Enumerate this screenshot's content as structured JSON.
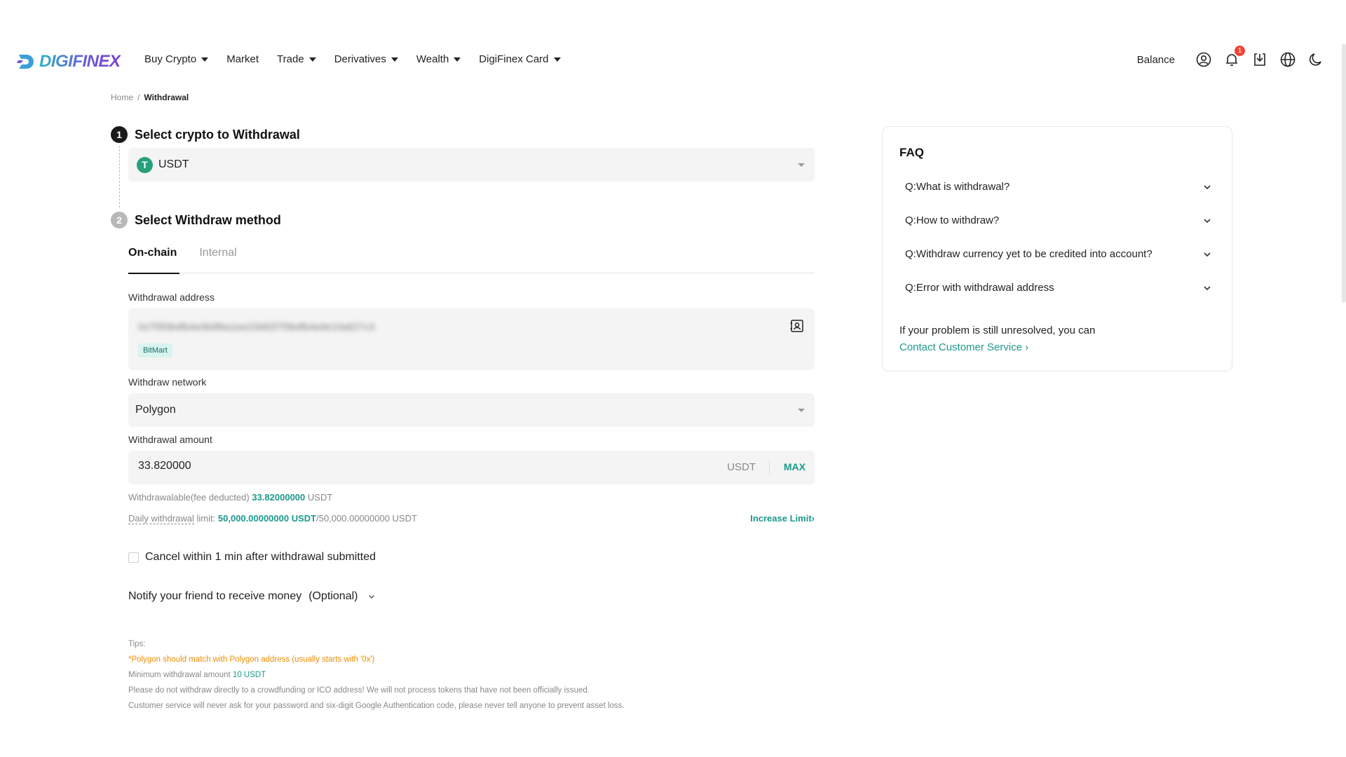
{
  "brand": {
    "name": "DIGIFINEX"
  },
  "nav": {
    "items": [
      {
        "label": "Buy Crypto",
        "dropdown": true
      },
      {
        "label": "Market",
        "dropdown": false
      },
      {
        "label": "Trade",
        "dropdown": true
      },
      {
        "label": "Derivatives",
        "dropdown": true
      },
      {
        "label": "Wealth",
        "dropdown": true
      },
      {
        "label": "DigiFinex Card",
        "dropdown": true
      }
    ],
    "balance_label": "Balance",
    "notification_count": "1",
    "icons": [
      "user-icon",
      "bell-icon",
      "download-icon",
      "globe-icon",
      "moon-icon"
    ]
  },
  "breadcrumb": {
    "home": "Home",
    "separator": "/",
    "current": "Withdrawal"
  },
  "step1": {
    "number": "1",
    "title": "Select crypto to Withdrawal",
    "coin_symbol": "T",
    "coin": "USDT"
  },
  "step2": {
    "number": "2",
    "title": "Select Withdraw method"
  },
  "tabs": [
    {
      "label": "On-chain",
      "active": true
    },
    {
      "label": "Internal",
      "active": false
    }
  ],
  "form": {
    "address_label": "Withdrawal address",
    "address_value": "0x7f3f3b4fb4e0b9fba1ee22b82f7f3b4fb4e9e10a627c3",
    "address_tag": "BitMart",
    "network_label": "Withdraw network",
    "network_value": "Polygon",
    "amount_label": "Withdrawal amount",
    "amount_value": "33.820000",
    "amount_unit": "USDT",
    "max_label": "MAX",
    "withdrawable_prefix": "Withdrawalable(fee deducted)",
    "withdrawable_value": "33.82000000",
    "withdrawable_unit": "USDT",
    "daily_prefix": "Daily withdrawal",
    "daily_limit_word": " limit:",
    "daily_used": "50,000.00000000 USDT",
    "daily_total": "/50,000.00000000 USDT",
    "increase_label": "Increase Limit",
    "cancel_label": "Cancel within 1 min after withdrawal submitted",
    "notify_label": "Notify your friend to receive money",
    "notify_optional": "(Optional)"
  },
  "tips": {
    "heading": "Tips:",
    "warning": "*Polygon should match with Polygon address (usually starts with '0x')",
    "min_prefix": "Minimum withdrawal amount",
    "min_value": "10 USDT",
    "line3": "Please do not withdraw directly to a crowdfunding or ICO address! We will not process tokens that have not been officially issued.",
    "line4": "Customer service will never ask for your password and six-digit Google Authentication code, please never tell anyone to prevent asset loss."
  },
  "faq": {
    "title": "FAQ",
    "items": [
      "Q:What is withdrawal?",
      "Q:How to withdraw?",
      "Q:Withdraw currency yet to be credited into account?",
      "Q:Error with withdrawal address"
    ],
    "footer_text": "If your problem is still unresolved, you can",
    "contact_link": "Contact Customer Service",
    "contact_arrow": "›"
  },
  "colors": {
    "accent": "#1a9a8c",
    "warning": "#f08c00",
    "badge": "#f44336",
    "tether": "#26a17b"
  }
}
